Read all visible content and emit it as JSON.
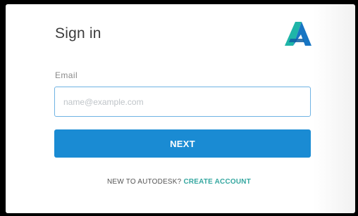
{
  "signin": {
    "title": "Sign in",
    "email_label": "Email",
    "email_placeholder": "name@example.com",
    "email_value": "",
    "next_label": "NEXT",
    "footer_prompt": "NEW TO AUTODESK?",
    "create_account_label": "CREATE ACCOUNT"
  },
  "brand": {
    "logo_icon": "autodesk-logo-icon",
    "accent": "#1a8bd3",
    "logo_teal": "#1fb5a8",
    "logo_blue": "#1775c3",
    "link_color": "#35a7a0"
  }
}
